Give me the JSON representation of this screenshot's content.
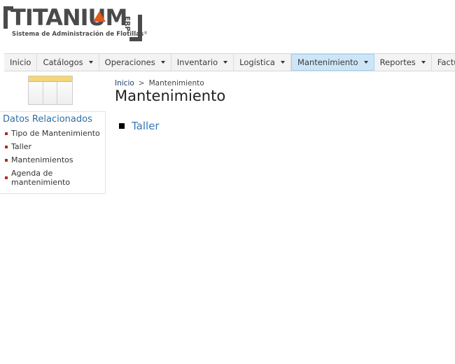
{
  "logo": {
    "word": "TITANIUM",
    "erp": "ERP",
    "subtitle": "Sistema de Administración de Flotillas",
    "reg": "®"
  },
  "nav": {
    "items": [
      {
        "label": "Inicio",
        "dropdown": false
      },
      {
        "label": "Catálogos",
        "dropdown": true
      },
      {
        "label": "Operaciones",
        "dropdown": true
      },
      {
        "label": "Inventario",
        "dropdown": true
      },
      {
        "label": "Logística",
        "dropdown": true
      },
      {
        "label": "Mantenimiento",
        "dropdown": true,
        "active": true
      },
      {
        "label": "Reportes",
        "dropdown": true
      },
      {
        "label": "Facturación",
        "dropdown": false
      }
    ]
  },
  "related": {
    "title": "Datos Relacionados",
    "items": [
      "Tipo de Mantenimiento",
      "Taller",
      "Mantenimientos",
      "Agenda de mantenimiento"
    ]
  },
  "breadcrumb": {
    "home": "Inicio",
    "separator": ">",
    "current": "Mantenimiento"
  },
  "page": {
    "title": "Mantenimiento",
    "items": [
      "Taller"
    ]
  },
  "colors": {
    "accent_link": "#3478b5",
    "active_nav": "#cde6f7",
    "bullet_red": "#b22a1c",
    "logo_gray": "#4a4a4a",
    "logo_orange": "#e25a1c"
  }
}
